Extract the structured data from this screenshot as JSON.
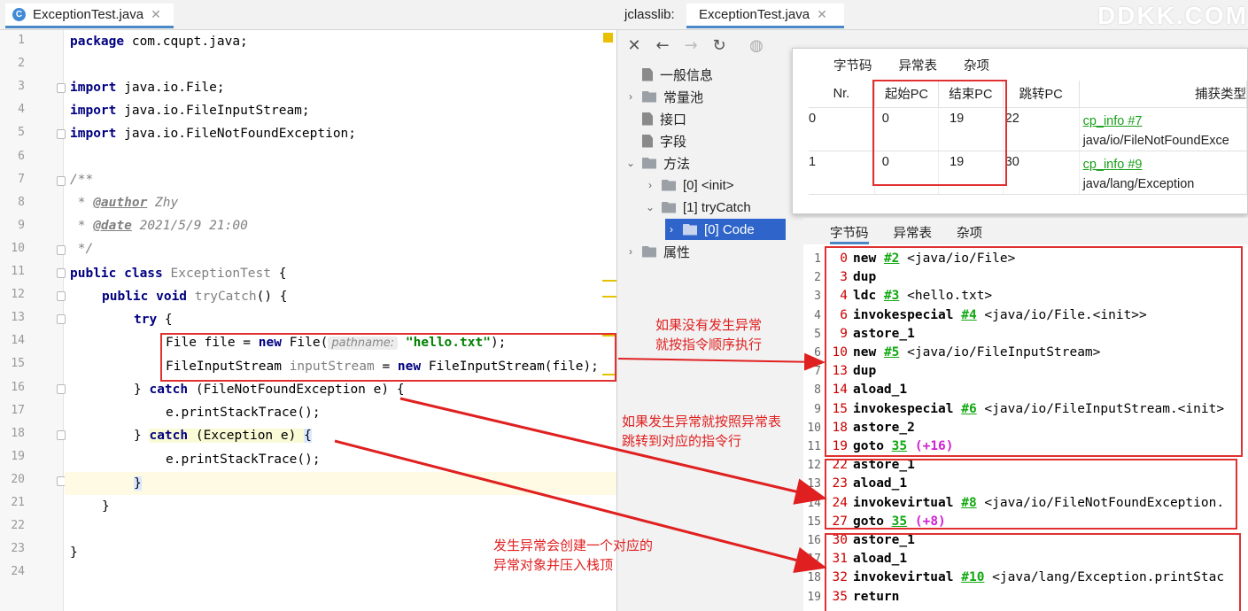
{
  "editor": {
    "tab_label": "ExceptionTest.java",
    "tab_icon_letter": "C",
    "line_numbers": [
      "1",
      "2",
      "3",
      "4",
      "5",
      "6",
      "7",
      "8",
      "9",
      "10",
      "11",
      "12",
      "13",
      "14",
      "15",
      "16",
      "17",
      "18",
      "19",
      "20",
      "21",
      "22",
      "23",
      "24"
    ],
    "code": {
      "l1_kw": "package",
      "l1_rest": " com.cqupt.java;",
      "l3_kw": "import",
      "l3_rest": " java.io.File;",
      "l4_kw": "import",
      "l4_rest": " java.io.FileInputStream;",
      "l5_kw": "import",
      "l5_rest": " java.io.FileNotFoundException;",
      "l7": "/**",
      "l8_pre": " * ",
      "l8_tag": "@author",
      "l8_val": " Zhy",
      "l9_pre": " * ",
      "l9_tag": "@date",
      "l9_val": " 2021/5/9 21:00",
      "l10": " */",
      "l11_kw": "public class",
      "l11_name": " ExceptionTest",
      "l11_rest": " {",
      "l12_kw": "public void",
      "l12_name": " tryCatch",
      "l12_rest": "() {",
      "l13_kw": "try",
      "l13_rest": " {",
      "l14_a": "File file = ",
      "l14_kw": "new",
      "l14_b": " File(",
      "l14_hint": "pathname:",
      "l14_str": "\"hello.txt\"",
      "l14_c": ");",
      "l15_a": "FileInputStream ",
      "l15_var": "inputStream",
      "l15_b": " = ",
      "l15_kw": "new",
      "l15_c": " FileInputStream(file);",
      "l16_a": "} ",
      "l16_kw": "catch",
      "l16_b": " (FileNotFoundException e) {",
      "l17": "e.printStackTrace();",
      "l18_a": "} ",
      "l18_kw": "catch",
      "l18_b": " (Exception e) ",
      "l18_c": "{",
      "l19": "e.printStackTrace();",
      "l20": "}",
      "l21": "}",
      "l23": "}"
    }
  },
  "jclasslib": {
    "prefix": "jclasslib:",
    "tab_label": "ExceptionTest.java",
    "watermark": "DDKK.COM",
    "toolbar": [
      "close",
      "back",
      "forward",
      "refresh",
      "browse"
    ],
    "tree": [
      {
        "label": "一般信息",
        "icon": "doc-icon",
        "expandable": false
      },
      {
        "label": "常量池",
        "icon": "folder-icon",
        "expandable": true
      },
      {
        "label": "接口",
        "icon": "doc-icon",
        "expandable": false
      },
      {
        "label": "字段",
        "icon": "doc-icon",
        "expandable": false
      },
      {
        "label": "方法",
        "icon": "folder-icon",
        "expandable": true
      },
      {
        "label": "[0] <init>",
        "icon": "folder-icon",
        "expandable": true
      },
      {
        "label": "[1] tryCatch",
        "icon": "folder-icon",
        "expandable": true
      },
      {
        "label": "[0] Code",
        "icon": "folder-icon",
        "expandable": true
      },
      {
        "label": "属性",
        "icon": "folder-icon",
        "expandable": true
      }
    ]
  },
  "exception_table": {
    "tabs": [
      "字节码",
      "异常表",
      "杂项"
    ],
    "headers": [
      "Nr.",
      "起始PC",
      "结束PC",
      "跳转PC",
      "捕获类型"
    ],
    "rows": [
      {
        "nr": "0",
        "start": "0",
        "end": "19",
        "handler": "22",
        "type_link": "cp_info #7",
        "type_name": "java/io/FileNotFoundExce"
      },
      {
        "nr": "1",
        "start": "0",
        "end": "19",
        "handler": "30",
        "type_link": "cp_info #9",
        "type_name": "java/lang/Exception"
      }
    ]
  },
  "bytecode": {
    "tabs": [
      "字节码",
      "异常表",
      "杂项"
    ],
    "lines": [
      {
        "ln": "1",
        "off": "0",
        "op": "new",
        "ref": "#2",
        "arg": " <java/io/File>"
      },
      {
        "ln": "2",
        "off": "3",
        "op": "dup",
        "ref": "",
        "arg": ""
      },
      {
        "ln": "3",
        "off": "4",
        "op": "ldc",
        "ref": "#3",
        "arg": " <hello.txt>"
      },
      {
        "ln": "4",
        "off": "6",
        "op": "invokespecial",
        "ref": "#4",
        "arg": " <java/io/File.<init>>"
      },
      {
        "ln": "5",
        "off": "9",
        "op": "astore_1",
        "ref": "",
        "arg": ""
      },
      {
        "ln": "6",
        "off": "10",
        "op": "new",
        "ref": "#5",
        "arg": " <java/io/FileInputStream>"
      },
      {
        "ln": "7",
        "off": "13",
        "op": "dup",
        "ref": "",
        "arg": ""
      },
      {
        "ln": "8",
        "off": "14",
        "op": "aload_1",
        "ref": "",
        "arg": ""
      },
      {
        "ln": "9",
        "off": "15",
        "op": "invokespecial",
        "ref": "#6",
        "arg": " <java/io/FileInputStream.<init>"
      },
      {
        "ln": "10",
        "off": "18",
        "op": "astore_2",
        "ref": "",
        "arg": ""
      },
      {
        "ln": "11",
        "off": "19",
        "op": "goto",
        "ref": "35",
        "arg": "",
        "rel": " (+16)"
      },
      {
        "ln": "12",
        "off": "22",
        "op": "astore_1",
        "ref": "",
        "arg": ""
      },
      {
        "ln": "13",
        "off": "23",
        "op": "aload_1",
        "ref": "",
        "arg": ""
      },
      {
        "ln": "14",
        "off": "24",
        "op": "invokevirtual",
        "ref": "#8",
        "arg": " <java/io/FileNotFoundException."
      },
      {
        "ln": "15",
        "off": "27",
        "op": "goto",
        "ref": "35",
        "arg": "",
        "rel": " (+8)"
      },
      {
        "ln": "16",
        "off": "30",
        "op": "astore_1",
        "ref": "",
        "arg": ""
      },
      {
        "ln": "17",
        "off": "31",
        "op": "aload_1",
        "ref": "",
        "arg": ""
      },
      {
        "ln": "18",
        "off": "32",
        "op": "invokevirtual",
        "ref": "#10",
        "arg": " <java/lang/Exception.printStac"
      },
      {
        "ln": "19",
        "off": "35",
        "op": "return",
        "ref": "",
        "arg": ""
      }
    ]
  },
  "annotations": {
    "a1_line1": "如果没有发生异常",
    "a1_line2": "就按指令顺序执行",
    "a2_line1": "如果发生异常就按照异常表",
    "a2_line2": "跳转到对应的指令行",
    "a3_line1": "发生异常会创建一个对应的",
    "a3_line2": "异常对象并压入栈顶"
  },
  "colors": {
    "annotation_red": "#e02020",
    "keyword": "#000080",
    "string": "#008000",
    "link_green": "#1aa01a",
    "selection_blue": "#2f65ca"
  }
}
